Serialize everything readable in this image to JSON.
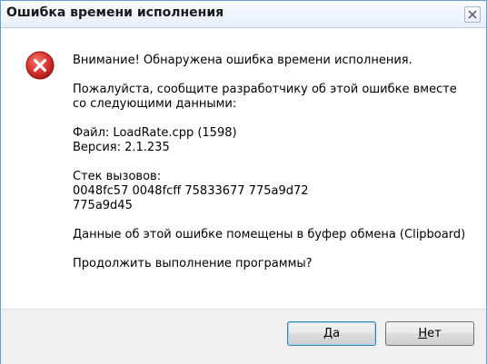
{
  "window": {
    "title": "Ошибка времени исполнения"
  },
  "dialog": {
    "icon": "error-icon",
    "message_lines": [
      [
        "Внимание! Обнаружена ошибка времени исполнения."
      ],
      [
        "Пожалуйста, сообщите разработчику об этой ошибке вместе",
        "со следующими данными:"
      ],
      [
        "Файл: LoadRate.cpp (1598)",
        "Версия: 2.1.235"
      ],
      [
        "Стек вызовов:",
        "0048fc57 0048fcff 75833677 775a9d72",
        "775a9d45"
      ],
      [
        "Данные об этой ошибке помещены в буфер обмена (Clipboard)"
      ],
      [
        "Продолжить выполнение программы?"
      ]
    ]
  },
  "buttons": {
    "yes_mnemonic": "Д",
    "yes_rest": "а",
    "no_mnemonic": "Н",
    "no_rest": "ет"
  },
  "colors": {
    "error_red": "#d9302c",
    "title_border": "#6d9bcc",
    "default_button_border": "#3c7fb1"
  }
}
